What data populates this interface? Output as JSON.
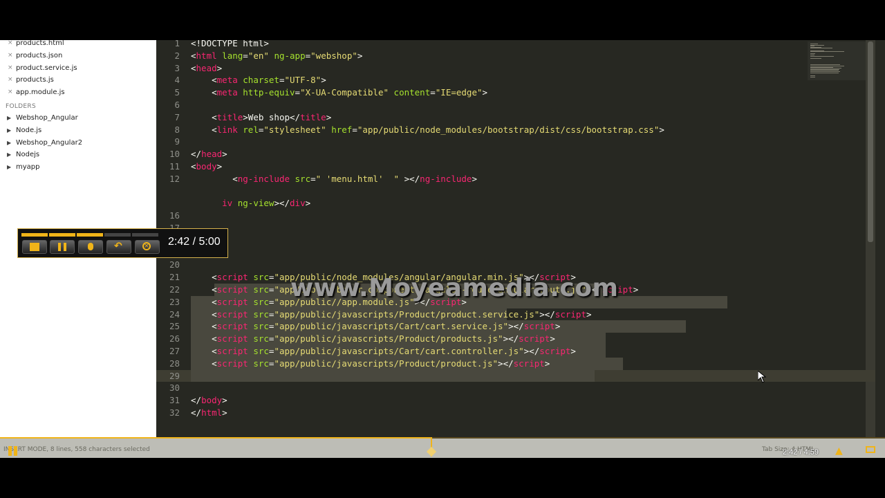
{
  "sidebar": {
    "open_files": [
      "products.html",
      "products.json",
      "product.service.js",
      "products.js",
      "app.module.js"
    ],
    "folders_title": "FOLDERS",
    "folders": [
      "Webshop_Angular",
      "Node.js",
      "Webshop_Angular2",
      "Nodejs",
      "myapp"
    ]
  },
  "editor": {
    "lines": [
      {
        "n": "1",
        "html": "<span class='p'>&lt;!DOCTYPE html&gt;</span>"
      },
      {
        "n": "2",
        "html": "<span class='p'>&lt;</span><span class='t'>html</span> <span class='a'>lang</span>=<span class='s'>\"en\"</span> <span class='a'>ng-app</span>=<span class='s'>\"webshop\"</span>&gt;"
      },
      {
        "n": "3",
        "html": "&lt;<span class='t'>head</span>&gt;"
      },
      {
        "n": "4",
        "html": "    &lt;<span class='t'>meta</span> <span class='a'>charset</span>=<span class='s'>\"UTF-8\"</span>&gt;"
      },
      {
        "n": "5",
        "html": "    &lt;<span class='t'>meta</span> <span class='a'>http-equiv</span>=<span class='s'>\"X-UA-Compatible\"</span> <span class='a'>content</span>=<span class='s'>\"IE=edge\"</span>&gt;"
      },
      {
        "n": "6",
        "html": ""
      },
      {
        "n": "7",
        "html": "    &lt;<span class='t'>title</span>&gt;Web shop&lt;/<span class='t'>title</span>&gt;"
      },
      {
        "n": "8",
        "html": "    &lt;<span class='t'>link</span> <span class='a'>rel</span>=<span class='s'>\"stylesheet\"</span> <span class='a'>href</span>=<span class='s'>\"app/public/node_modules/bootstrap/dist/css/bootstrap.css\"</span>&gt;"
      },
      {
        "n": "9",
        "html": ""
      },
      {
        "n": "10",
        "html": "&lt;/<span class='t'>head</span>&gt;"
      },
      {
        "n": "11",
        "html": "&lt;<span class='t'>body</span>&gt;"
      },
      {
        "n": "12",
        "html": "        &lt;<span class='t'>ng-include</span> <span class='a'>src</span>=<span class='s'>\" 'menu.html'  \"</span> &gt;&lt;/<span class='t'>ng-include</span>&gt;"
      },
      {
        "n": "",
        "html": ""
      },
      {
        "n": "",
        "html": "      <span class='t'>iv</span> <span class='a'>ng-view</span>&gt;&lt;/<span class='t'>div</span>&gt;"
      },
      {
        "n": "16",
        "html": ""
      },
      {
        "n": "17",
        "html": ""
      },
      {
        "n": "18",
        "html": ""
      },
      {
        "n": "19",
        "html": ""
      },
      {
        "n": "20",
        "html": ""
      },
      {
        "n": "21",
        "html": "    &lt;<span class='t'>script</span> <span class='a'>src</span>=<span class='s'>\"app/public/node_modules/angular/angular.min.js\"</span>&gt;&lt;/<span class='t'>script</span>&gt;"
      },
      {
        "n": "22",
        "html": "    &lt;<span class='t'>script</span> <span class='a'>src</span>=<span class='s'>\"app/public/bower_components/angular-route/angular-route.js\"</span>&gt;&lt;/<span class='t'>script</span>&gt;"
      },
      {
        "n": "23",
        "html": "    &lt;<span class='t'>script</span> <span class='a'>src</span>=<span class='s'>\"app/public//app.module.js\"</span>&gt;&lt;/<span class='t'>script</span>&gt;"
      },
      {
        "n": "24",
        "html": "    &lt;<span class='t'>script</span> <span class='a'>src</span>=<span class='s'>\"app/public/javascripts/Product/product.service.js\"</span>&gt;&lt;/<span class='t'>script</span>&gt;"
      },
      {
        "n": "25",
        "html": "    &lt;<span class='t'>script</span> <span class='a'>src</span>=<span class='s'>\"app/public/javascripts/Cart/cart.service.js\"</span>&gt;&lt;/<span class='t'>script</span>&gt;"
      },
      {
        "n": "26",
        "html": "    &lt;<span class='t'>script</span> <span class='a'>src</span>=<span class='s'>\"app/public/javascripts/Product/products.js\"</span>&gt;&lt;/<span class='t'>script</span>&gt;"
      },
      {
        "n": "27",
        "html": "    &lt;<span class='t'>script</span> <span class='a'>src</span>=<span class='s'>\"app/public/javascripts/Cart/cart.controller.js\"</span>&gt;&lt;/<span class='t'>script</span>&gt;"
      },
      {
        "n": "28",
        "html": "    &lt;<span class='t'>script</span> <span class='a'>src</span>=<span class='s'>\"app/public/javascripts/Product/product.js\"</span>&gt;&lt;/<span class='t'>script</span>&gt;"
      },
      {
        "n": "29",
        "html": ""
      },
      {
        "n": "30",
        "html": ""
      },
      {
        "n": "31",
        "html": "&lt;/<span class='t'>body</span>&gt;"
      },
      {
        "n": "32",
        "html": "&lt;/<span class='t'>html</span>&gt;"
      }
    ]
  },
  "watermark": "www.Moyeamedia.com",
  "recorder": {
    "time": "2:42 / 5:00",
    "progress": 0.54
  },
  "statusbar": {
    "text": "INSERT MODE, 8 lines, 558 characters selected",
    "right_text": "Tab Size: 4     HTML"
  },
  "player": {
    "time": "2:42 / 4:59",
    "progress": 0.487
  },
  "colors": {
    "tag": "#f92672",
    "attr": "#a6e22e",
    "string": "#e6db74",
    "accent": "#f0b419"
  }
}
